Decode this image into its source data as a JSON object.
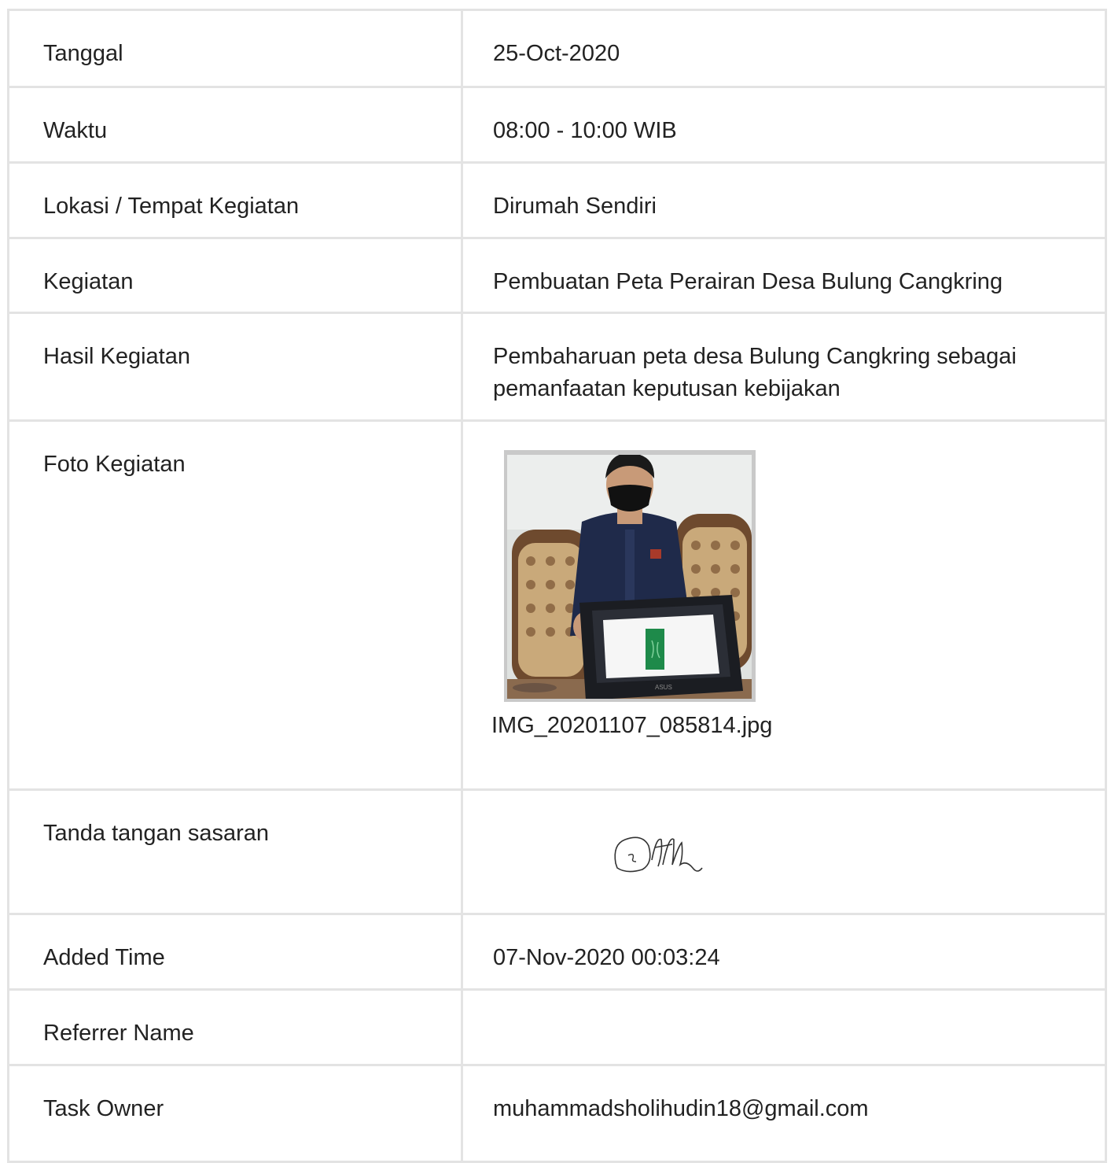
{
  "rows": {
    "tanggal": {
      "label": "Tanggal",
      "value": "25-Oct-2020"
    },
    "waktu": {
      "label": "Waktu",
      "value": "08:00 - 10:00 WIB"
    },
    "lokasi": {
      "label": "Lokasi / Tempat Kegiatan",
      "value": "Dirumah Sendiri"
    },
    "kegiatan": {
      "label": "Kegiatan",
      "value": "Pembuatan Peta Perairan Desa Bulung Cangkring"
    },
    "hasil": {
      "label": "Hasil Kegiatan",
      "value": "Pembaharuan peta desa Bulung Cangkring sebagai pemanfaatan keputusan kebijakan"
    },
    "foto": {
      "label": "Foto Kegiatan",
      "filename": "IMG_20201107_085814.jpg"
    },
    "ttd": {
      "label": "Tanda tangan sasaran"
    },
    "added": {
      "label": "Added Time",
      "value": "07-Nov-2020 00:03:24"
    },
    "referrer": {
      "label": "Referrer Name",
      "value": ""
    },
    "owner": {
      "label": "Task Owner",
      "value": "muhammadsholihudin18@gmail.com"
    }
  },
  "photo": {
    "laptop_brand": "ASUS"
  },
  "colors": {
    "border": "#e3e3e3",
    "text": "#222222",
    "jacket": "#1f2a4a",
    "screen_map": "#1e8a4a"
  }
}
